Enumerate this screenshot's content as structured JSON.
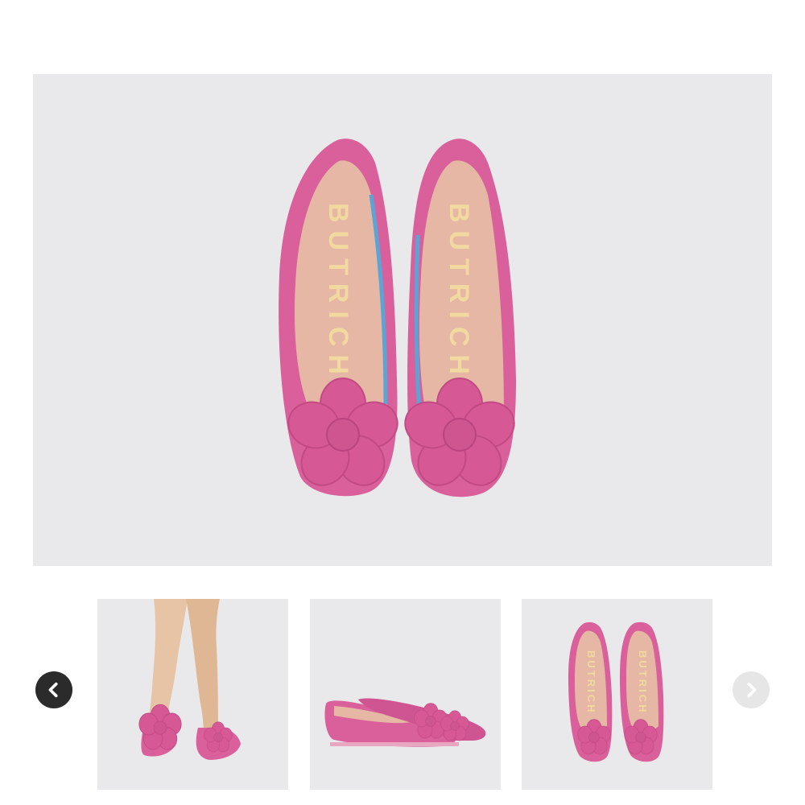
{
  "gallery": {
    "main_image": {
      "brand_text": "BUTRICH",
      "colors": {
        "background": "#e9e9eb",
        "shoe": "#d9609a",
        "lining": "#e7b7a6",
        "brand": "#f1d9a0",
        "accent": "#5aa5d6"
      }
    },
    "thumbnails": [
      {
        "view": "worn"
      },
      {
        "view": "side"
      },
      {
        "view": "top",
        "brand_text": "BUTRICH"
      }
    ],
    "prev_icon": "chevron-left-icon",
    "next_icon": "chevron-right-icon",
    "colors": {
      "prev_bg": "#2b2b2b",
      "next_bg": "#e6e6e6"
    }
  }
}
